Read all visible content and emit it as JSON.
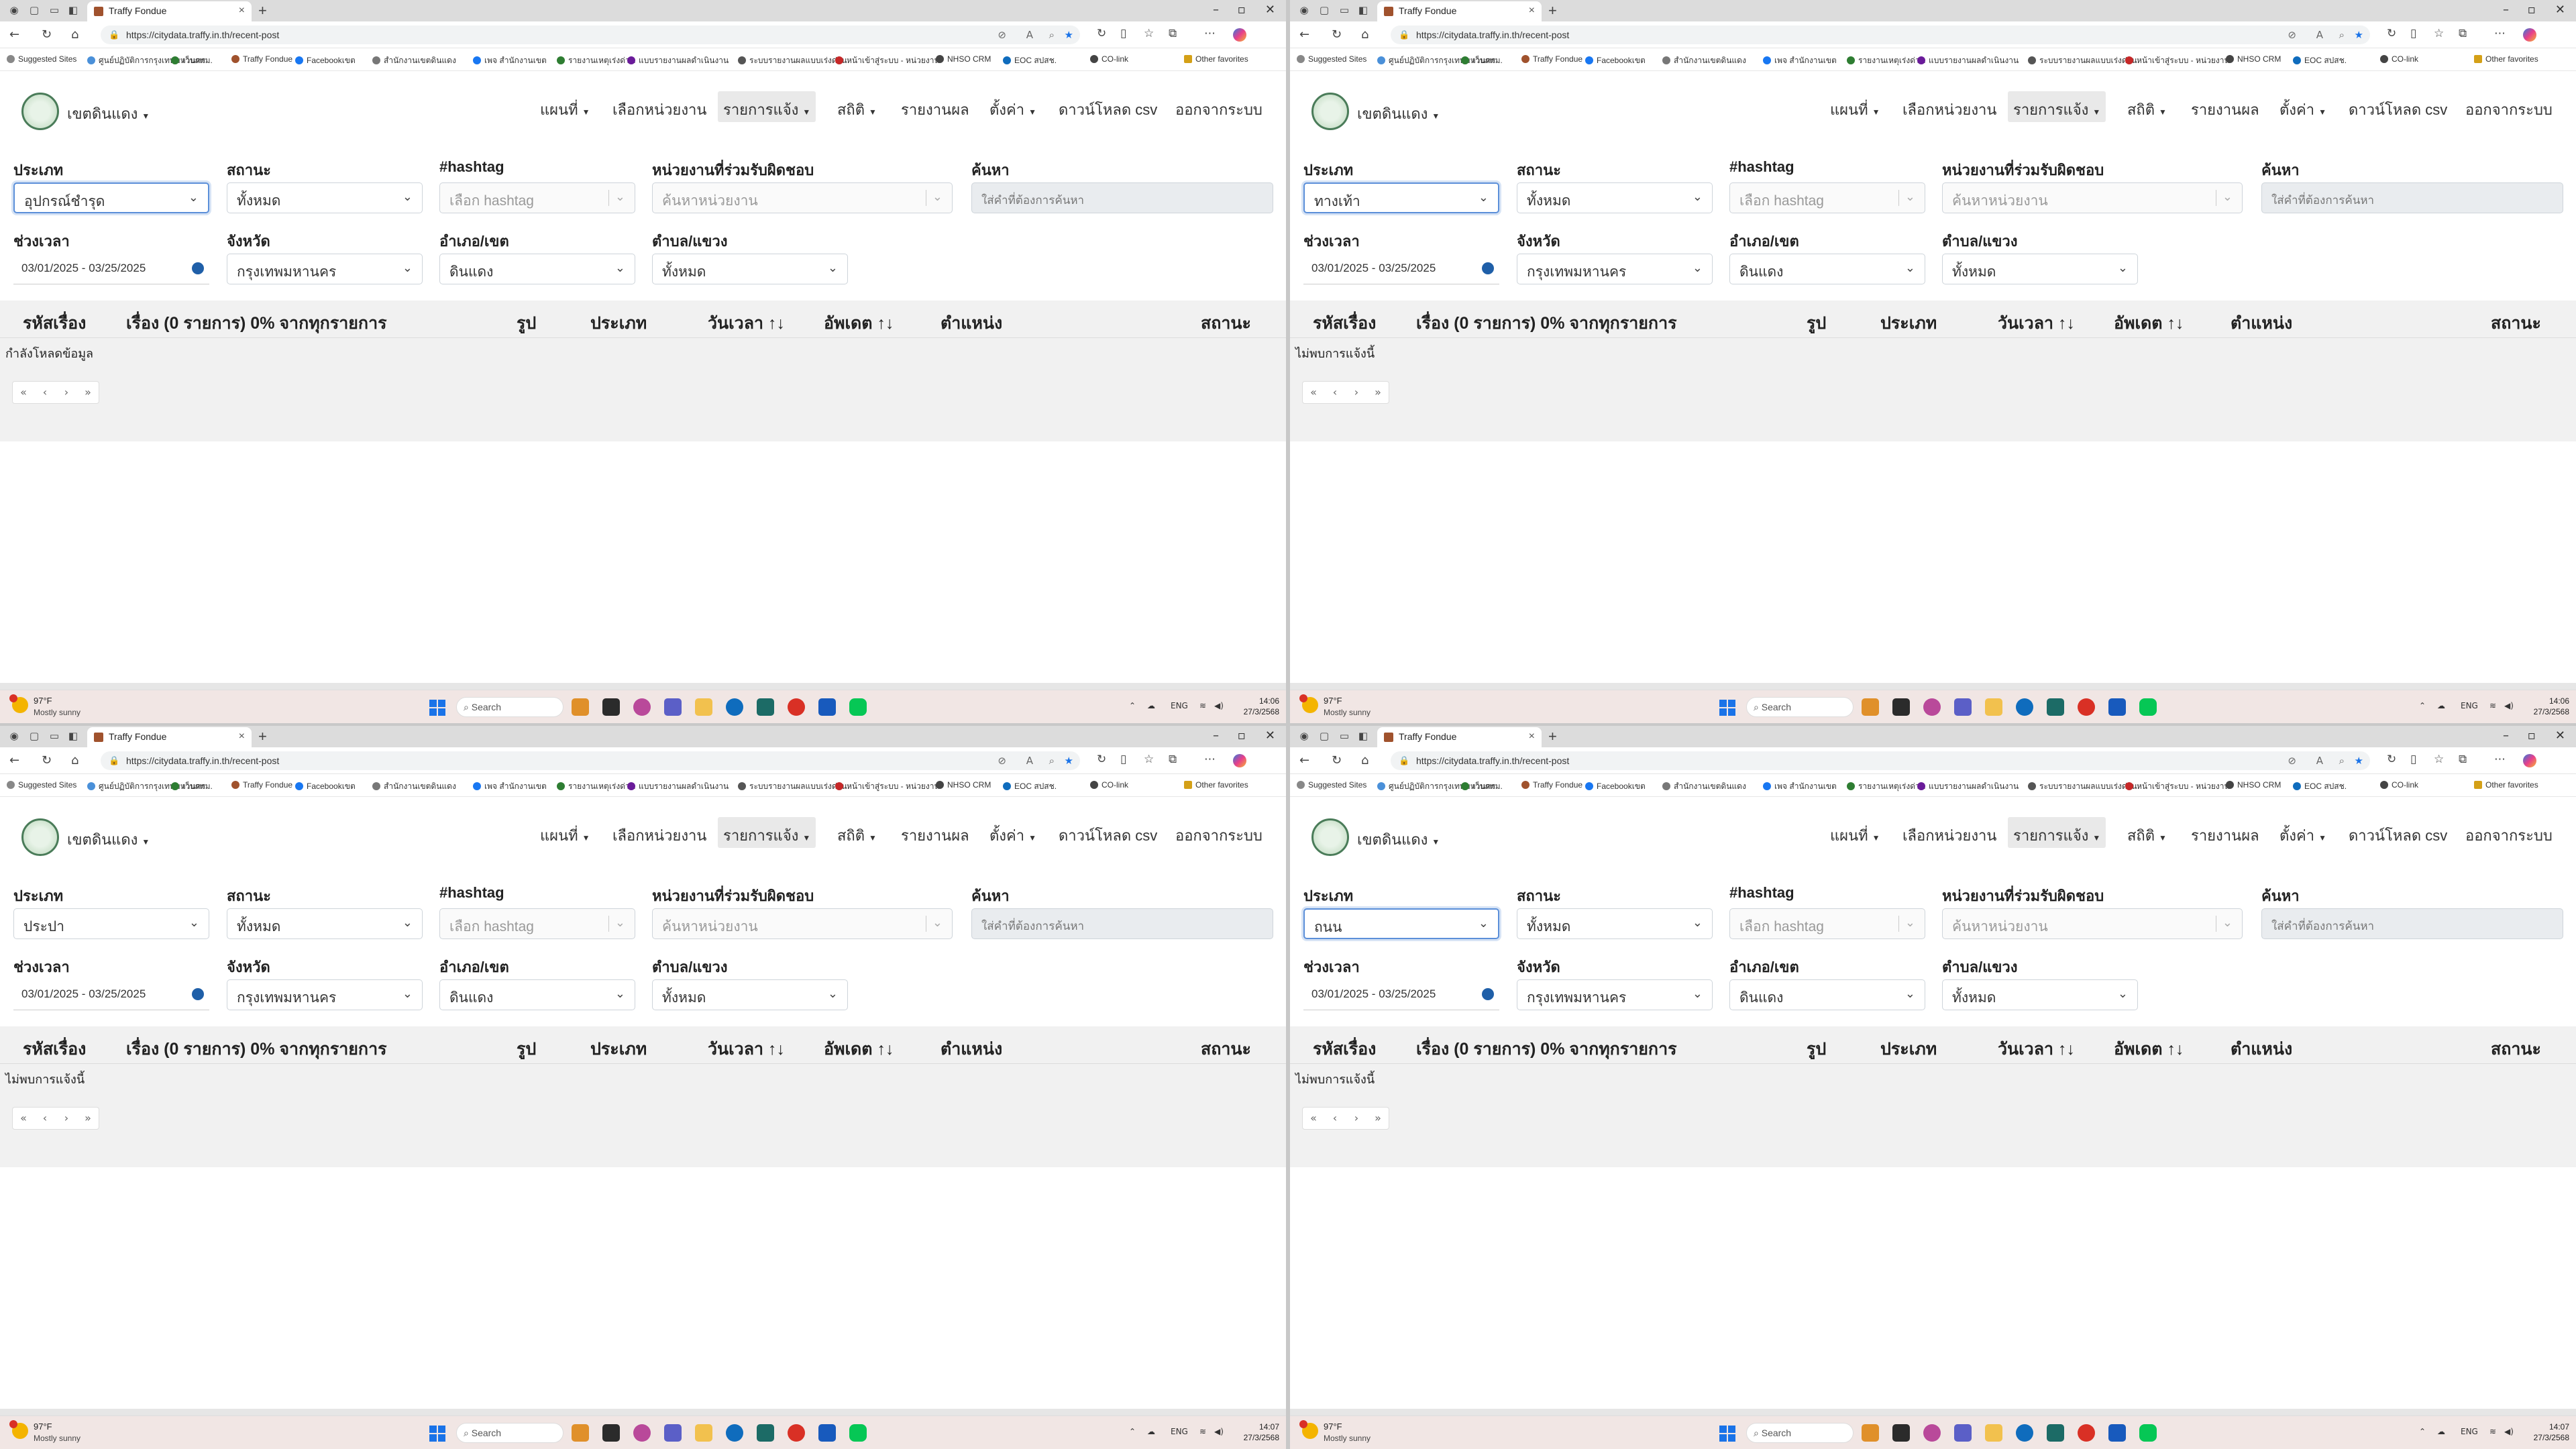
{
  "browser": {
    "tab_title": "Traffy Fondue",
    "url": "https://citydata.traffy.in.th/recent-post",
    "favorites": [
      "Suggested Sites",
      "ศูนย์ปฏิบัติการกรุงเทพมหานคร",
      "เว็บกทม.",
      "Traffy Fondue",
      "Facebookเขต",
      "สำนักงานเขตดินแดง",
      "เพจ สำนักงานเขต",
      "รายงานเหตุเร่งด่วน",
      "แบบรายงานผลดำเนินงาน",
      "ระบบรายงานผลแบบเร่งด่วน",
      "หน้าเข้าสู่ระบบ - หน่วยงาน",
      "NHSO CRM",
      "EOC สปสช.",
      "CO-link"
    ],
    "other_favorites": "Other favorites"
  },
  "page": {
    "brand": "เขตดินแดง",
    "menu": [
      "แผนที่",
      "เลือกหน่วยงาน",
      "รายการแจ้ง",
      "สถิติ",
      "รายงานผล",
      "ตั้งค่า",
      "ดาวน์โหลด csv",
      "ออกจากระบบ"
    ],
    "labels": {
      "type": "ประเภท",
      "status": "สถานะ",
      "hashtag": "#hashtag",
      "agency": "หน่วยงานที่ร่วมรับผิดชอบ",
      "search": "ค้นหา",
      "period": "ช่วงเวลา",
      "province": "จังหวัด",
      "district": "อำเภอ/เขต",
      "subdistrict": "ตำบล/แขวง"
    },
    "values": {
      "status": "ทั้งหมด",
      "hashtag_placeholder": "เลือก hashtag",
      "agency_placeholder": "ค้นหาหน่วยงาน",
      "search_placeholder": "ใส่คำที่ต้องการค้นหา",
      "period": "03/01/2025 - 03/25/2025",
      "province": "กรุงเทพมหานคร",
      "district": "ดินแดง",
      "subdistrict": "ทั้งหมด"
    },
    "table_headers": [
      "รหัสเรื่อง",
      "เรื่อง (0 รายการ) 0% จากทุกรายการ",
      "รูป",
      "ประเภท",
      "วันเวลา ↑↓",
      "อัพเดต ↑↓",
      "ตำแหน่ง",
      "สถานะ"
    ],
    "pager": [
      "«",
      "‹",
      "›",
      "»"
    ]
  },
  "taskbar": {
    "temp": "97°F",
    "weather": "Mostly sunny",
    "search": "Search",
    "lang": "ENG",
    "date": "27/3/2568"
  },
  "quadrants": [
    {
      "type_value": "อุปกรณ์ชำรุด",
      "type_focused": true,
      "message": "กำลังโหลดข้อมูล",
      "time": "14:06"
    },
    {
      "type_value": "ทางเท้า",
      "type_focused": true,
      "message": "ไม่พบการแจ้งนี้",
      "time": "14:06"
    },
    {
      "type_value": "ประปา",
      "type_focused": false,
      "message": "ไม่พบการแจ้งนี้",
      "time": "14:07"
    },
    {
      "type_value": "ถนน",
      "type_focused": true,
      "message": "ไม่พบการแจ้งนี้",
      "time": "14:07"
    }
  ]
}
